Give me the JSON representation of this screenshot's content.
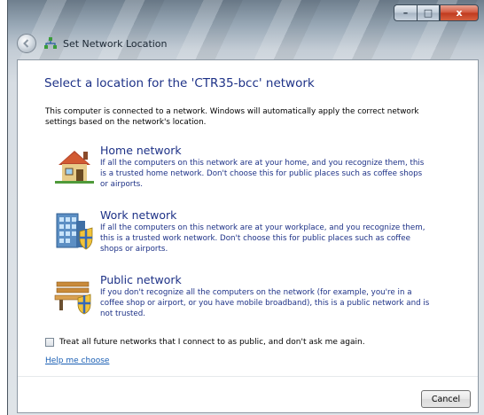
{
  "window": {
    "title": "Set Network Location",
    "controls": {
      "minimize": "–",
      "maximize": "□",
      "close": "x"
    }
  },
  "heading": "Select a location for the 'CTR35-bcc' network",
  "intro": "This computer is connected to a network. Windows will automatically apply the correct network settings based on the network's location.",
  "options": [
    {
      "title": "Home network",
      "description": "If all the computers on this network are at your home, and you recognize them, this is a trusted home network.  Don't choose this for public places such as coffee shops or airports.",
      "icon": "house-icon"
    },
    {
      "title": "Work network",
      "description": "If all the computers on this network are at your workplace, and you recognize them, this is a trusted work network.  Don't choose this for public places such as coffee shops or airports.",
      "icon": "office-building-icon"
    },
    {
      "title": "Public network",
      "description": "If you don't recognize all the computers on the network (for example, you're in a coffee shop or airport, or you have mobile broadband), this is a public network and is not trusted.",
      "icon": "park-bench-icon"
    }
  ],
  "checkbox": {
    "label": "Treat all future networks that I connect to as public, and don't ask me again.",
    "checked": false
  },
  "help_link": "Help me choose",
  "cancel_label": "Cancel",
  "colors": {
    "heading": "#1e3287",
    "link": "#1a5fb4",
    "close_button": "#c03a1e"
  }
}
